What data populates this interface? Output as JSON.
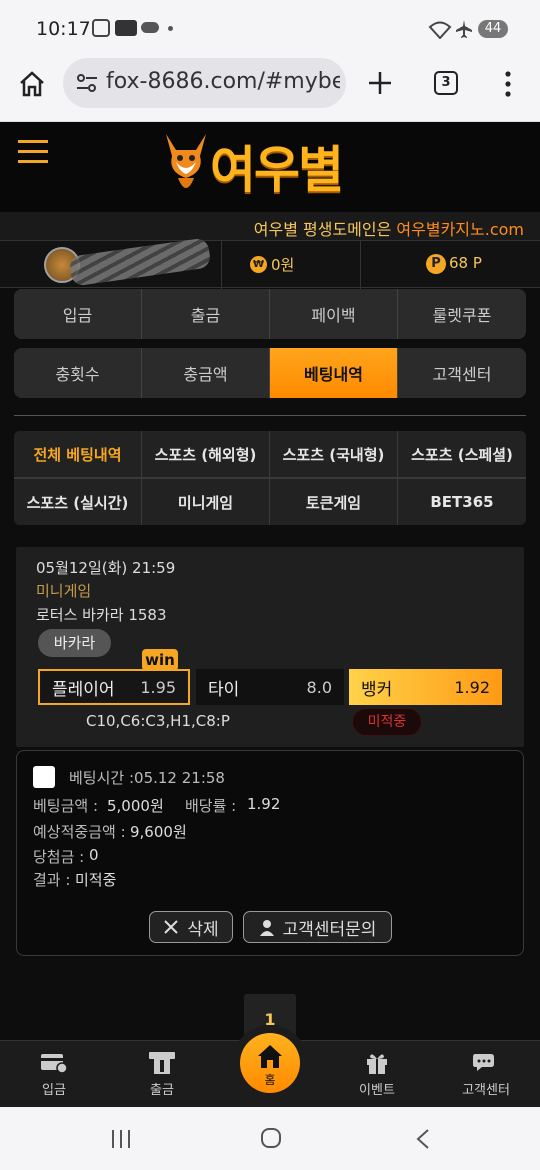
{
  "status": {
    "time": "10:17",
    "battery": "44",
    "wifi_level": "5"
  },
  "browser": {
    "url": "fox-8686.com/#mybe",
    "tab_count": "3"
  },
  "site": {
    "logo_text": "여우별",
    "domain_notice_prefix": "여우별 평생도메인은 ",
    "domain_notice_link": "여우별카지노.com",
    "balance": "0원",
    "points": "68 P",
    "balance_icon": "₩",
    "points_icon": "P"
  },
  "top_tabs": [
    {
      "label": "입금"
    },
    {
      "label": "출금"
    },
    {
      "label": "페이백"
    },
    {
      "label": "룰렛쿠폰"
    }
  ],
  "second_tabs": [
    {
      "label": "충횟수"
    },
    {
      "label": "충금액"
    },
    {
      "label": "베팅내역",
      "active": true
    },
    {
      "label": "고객센터"
    }
  ],
  "bet_tabs": [
    {
      "label": "전체 베팅내역",
      "active": true
    },
    {
      "label": "스포츠 (해외형)"
    },
    {
      "label": "스포츠 (국내형)"
    },
    {
      "label": "스포츠 (스페셜)"
    },
    {
      "label": "스포츠 (실시간)"
    },
    {
      "label": "미니게임"
    },
    {
      "label": "토큰게임"
    },
    {
      "label": "BET365"
    }
  ],
  "bet": {
    "datetime": "05월12일(화) 21:59",
    "category": "미니게임",
    "game": "로터스 바카라 1583",
    "tag": "바카라",
    "win_badge": "win",
    "options": [
      {
        "label": "플레이어",
        "odds": "1.95"
      },
      {
        "label": "타이",
        "odds": "8.0"
      },
      {
        "label": "뱅커",
        "odds": "1.92"
      }
    ],
    "result_text": "C10,C6:C3,H1,C8:P",
    "status": "미적중"
  },
  "detail": {
    "bet_time": "베팅시간 :05.12 21:58",
    "amount_label": "베팅금액 :",
    "amount": "5,000원",
    "rate_label": "배당률 :",
    "rate": "1.92",
    "expected_label": "예상적중금액 :",
    "expected": "9,600원",
    "win_label": "당첨금 :",
    "win": "0",
    "result_label": "결과 :",
    "result": "미적중",
    "delete_label": "삭제",
    "inquiry_label": "고객센터문의"
  },
  "pagination": {
    "current": "1"
  },
  "bottom_nav": [
    {
      "label": "입금",
      "icon": "deposit-icon"
    },
    {
      "label": "출금",
      "icon": "withdraw-icon"
    },
    {
      "label": "홈",
      "icon": "home-icon"
    },
    {
      "label": "이벤트",
      "icon": "gift-icon"
    },
    {
      "label": "고객센터",
      "icon": "chat-icon"
    }
  ],
  "colors": {
    "accent": "#ff9a14",
    "gold": "#f5a623",
    "loss": "#e03030"
  }
}
